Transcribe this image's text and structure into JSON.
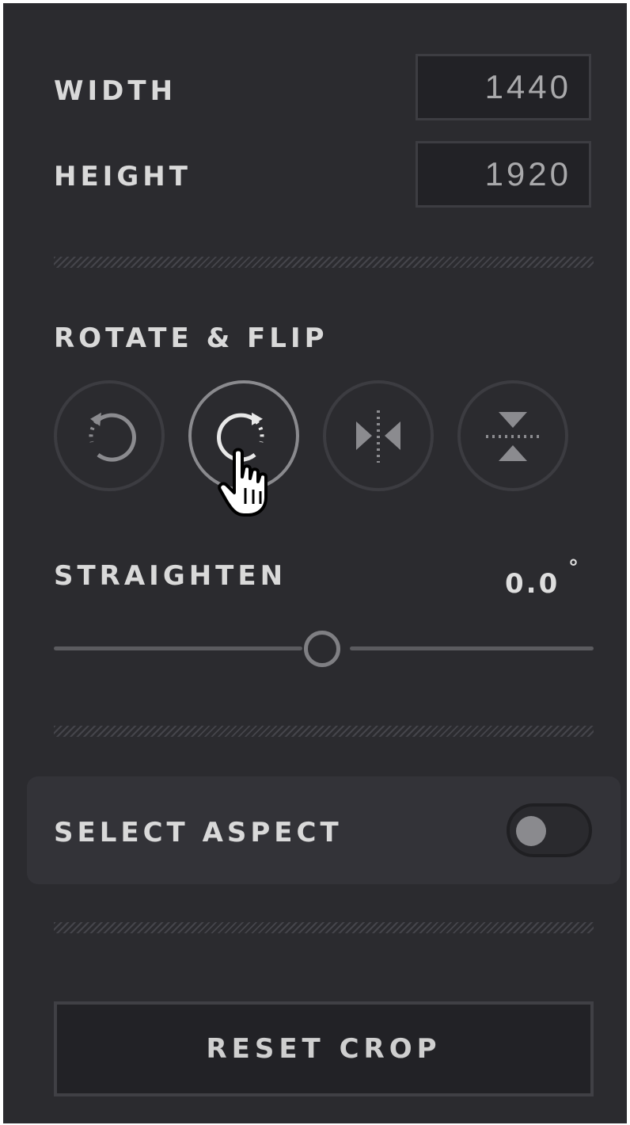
{
  "dimensions": {
    "width_label": "WIDTH",
    "width_value": "1440",
    "height_label": "HEIGHT",
    "height_value": "1920"
  },
  "rotate_flip": {
    "title": "ROTATE & FLIP",
    "buttons": [
      {
        "icon": "rotate-left-icon",
        "active": false
      },
      {
        "icon": "rotate-right-icon",
        "active": true
      },
      {
        "icon": "flip-horizontal-icon",
        "active": false
      },
      {
        "icon": "flip-vertical-icon",
        "active": false
      }
    ]
  },
  "straighten": {
    "title": "STRAIGHTEN",
    "value": "0.0",
    "unit": "°",
    "level": 0.5
  },
  "aspect": {
    "label": "SELECT ASPECT",
    "toggle_on": false
  },
  "reset": {
    "label": "RESET CROP"
  },
  "colors": {
    "panel_bg": "#2b2b2f",
    "text": "#d9d9d9",
    "field_bg": "#222226",
    "border": "#3c3c41",
    "active_border": "#8a8a8e"
  }
}
